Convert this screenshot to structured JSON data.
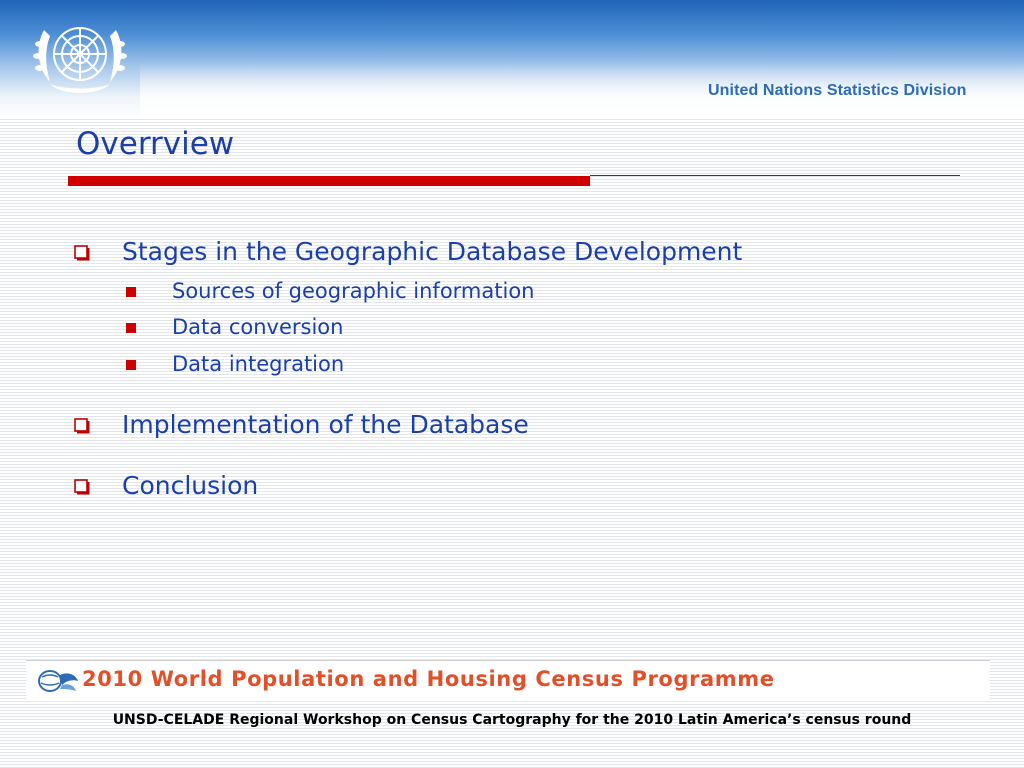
{
  "header": {
    "organization": "United Nations Statistics Division",
    "emblem_icon": "un-emblem-icon"
  },
  "slide": {
    "title": "Overrview",
    "accent_color": "#d00000",
    "text_color": "#1a3fa8"
  },
  "bullets": [
    {
      "label": "Stages in the Geographic Database Development",
      "sub": [
        "Sources of geographic information",
        "Data conversion",
        "Data integration"
      ]
    },
    {
      "label": "Implementation of the Database",
      "sub": []
    },
    {
      "label": "Conclusion",
      "sub": []
    }
  ],
  "banner": {
    "text": "2010 World Population and Housing Census Programme",
    "color": "#e2502a"
  },
  "footer": {
    "text": "UNSD-CELADE Regional Workshop on Census Cartography for the 2010 Latin America’s census round"
  }
}
